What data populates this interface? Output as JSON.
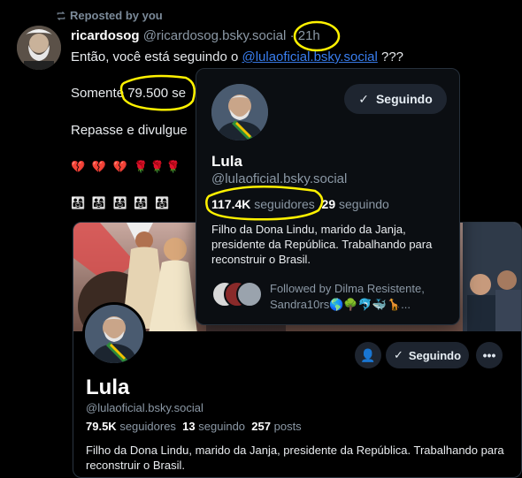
{
  "repost": {
    "label": "Reposted by you",
    "icon": "repost-icon"
  },
  "post": {
    "author_name": "ricardosog",
    "author_handle": "@ricardosog.bsky.social",
    "time": "21h",
    "line1_prefix": "Então, você está seguindo o",
    "line1_link": "@lulaoficial.bsky.social",
    "line1_suffix": "???",
    "line2": "Somente 79.500 se",
    "line3": "Repasse e divulgue",
    "emojis1": "💔 💔 💔 🌹🌹🌹",
    "emojis2": "👨‍👩‍👧 👨‍👩‍👧 👨‍👩‍👧 👨‍👩‍👧 👨‍👩‍👧"
  },
  "card": {
    "name": "Lula",
    "handle": "@lulaoficial.bsky.social",
    "followers": "79.5K",
    "followers_label": "seguidores",
    "following": "13",
    "following_label": "seguindo",
    "posts": "257",
    "posts_label": "posts",
    "bio": "Filho da Dona Lindu, marido da Janja, presidente da República. Trabalhando para reconstruir o Brasil.",
    "follow_label": "Seguindo"
  },
  "popup": {
    "name": "Lula",
    "handle": "@lulaoficial.bsky.social",
    "followers": "117.4K",
    "followers_label": "seguidores",
    "following": "29",
    "following_label": "seguindo",
    "bio": "Filho da Dona Lindu, marido da Janja, presidente da República. Trabalhando para reconstruir o Brasil.",
    "follow_label": "Seguindo",
    "followed_line1": "Followed by Dilma Resistente,",
    "followed_line2": "Sandra10rs🌎🌳🐬🐳🦒..."
  },
  "colors": {
    "accent": "#3b82f6",
    "highlight": "#fff200"
  }
}
